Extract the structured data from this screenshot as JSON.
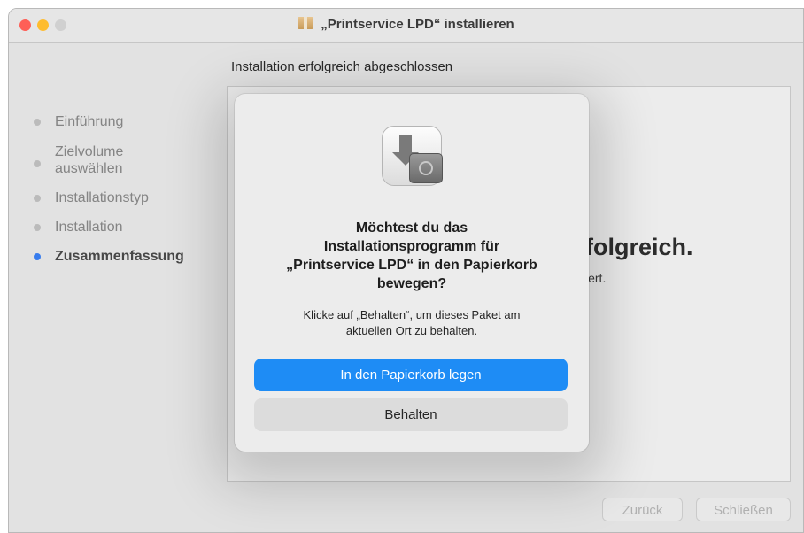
{
  "window": {
    "title": "„Printservice LPD“ installieren",
    "subtitle": "Installation erfolgreich abgeschlossen"
  },
  "sidebar": {
    "steps": [
      {
        "label": "Einführung",
        "state": "done"
      },
      {
        "label": "Zielvolume",
        "label2": "auswählen",
        "state": "done"
      },
      {
        "label": "Installationstyp",
        "state": "done"
      },
      {
        "label": "Installation",
        "state": "done"
      },
      {
        "label": "Zusammenfassung",
        "state": "active"
      }
    ]
  },
  "background": {
    "heading_fragment": "folgreich.",
    "sub_fragment": "iert."
  },
  "footer": {
    "back_label": "Zurück",
    "close_label": "Schließen"
  },
  "dialog": {
    "icon": "installer-package-icon",
    "title_line1": "Möchtest du das",
    "title_line2": "Installationsprogramm für",
    "title_line3": "„Printservice LPD“ in den Papierkorb",
    "title_line4": "bewegen?",
    "message_line1": "Klicke auf „Behalten“, um dieses Paket am",
    "message_line2": "aktuellen Ort zu behalten.",
    "primary_button": "In den Papierkorb legen",
    "secondary_button": "Behalten"
  },
  "colors": {
    "accent": "#1e8cf5",
    "active_step": "#3a82f7",
    "close": "#fe5f57",
    "minimize": "#febc2e"
  }
}
